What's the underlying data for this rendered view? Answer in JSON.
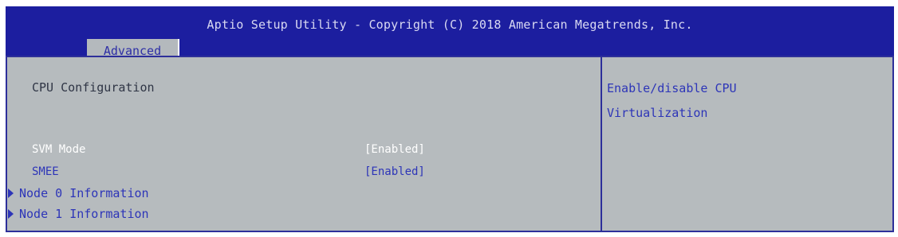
{
  "header": {
    "title": "Aptio Setup Utility - Copyright (C) 2018 American Megatrends, Inc.",
    "active_tab": "Advanced"
  },
  "main": {
    "title": "CPU Configuration",
    "settings": [
      {
        "label": "SVM Mode",
        "value": "[Enabled]"
      },
      {
        "label": "SMEE",
        "value": "[Enabled]"
      }
    ],
    "submenus": [
      {
        "label": "Node 0 Information",
        "icon": "triangle-right-icon"
      },
      {
        "label": "Node 1 Information",
        "icon": "triangle-right-icon"
      }
    ]
  },
  "help": {
    "line1": "Enable/disable CPU",
    "line2": "Virtualization"
  },
  "colors": {
    "header_bg": "#1c1e9f",
    "panel_bg": "#b6bbbe",
    "accent_blue": "#2d35b8",
    "highlight_white": "#ffffff"
  }
}
